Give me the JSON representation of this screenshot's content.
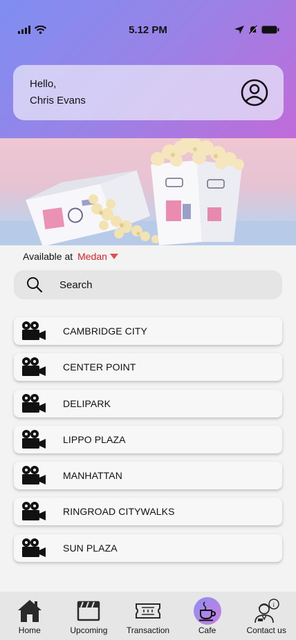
{
  "status_bar": {
    "time": "5.12 PM"
  },
  "greeting": {
    "hello": "Hello,",
    "name": "Chris Evans"
  },
  "location": {
    "prefix": "Available at",
    "city": "Medan"
  },
  "search": {
    "placeholder": "Search"
  },
  "cinemas": [
    "CAMBRIDGE CITY",
    "CENTER POINT",
    "DELIPARK",
    "LIPPO PLAZA",
    "MANHATTAN",
    "RINGROAD CITYWALKS",
    "SUN PLAZA"
  ],
  "nav": [
    {
      "label": "Home",
      "icon": "home-icon"
    },
    {
      "label": "Upcoming",
      "icon": "clapperboard-icon"
    },
    {
      "label": "Transaction",
      "icon": "ticket-icon"
    },
    {
      "label": "Cafe",
      "icon": "coffee-cup-icon",
      "active": true
    },
    {
      "label": "Contact us",
      "icon": "support-agent-icon"
    }
  ],
  "colors": {
    "accent_red": "#e02020",
    "header_gradient_start": "#7f8ef2",
    "header_gradient_end": "#c06bd9"
  }
}
